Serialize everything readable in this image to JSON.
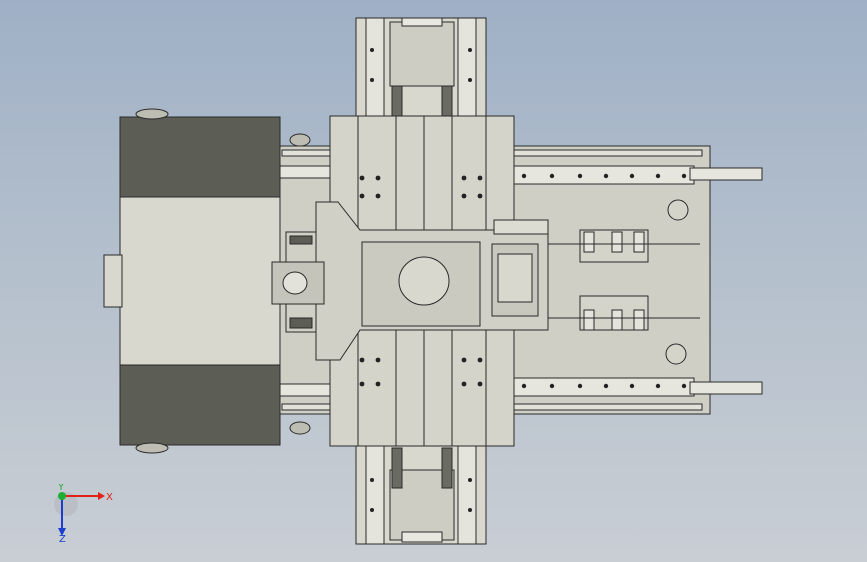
{
  "viewport": {
    "background_top": "#9fb0c6",
    "background_bottom": "#c9ced4"
  },
  "model": {
    "part_color": "#d8d8cf",
    "dark_part_color": "#5c5e55",
    "edge_color": "#2a2a2a"
  },
  "triad": {
    "x_label": "X",
    "y_label": "Y",
    "z_label": "Z",
    "x_color": "#e0201a",
    "y_color": "#1fae35",
    "z_color": "#1a3fd0"
  }
}
